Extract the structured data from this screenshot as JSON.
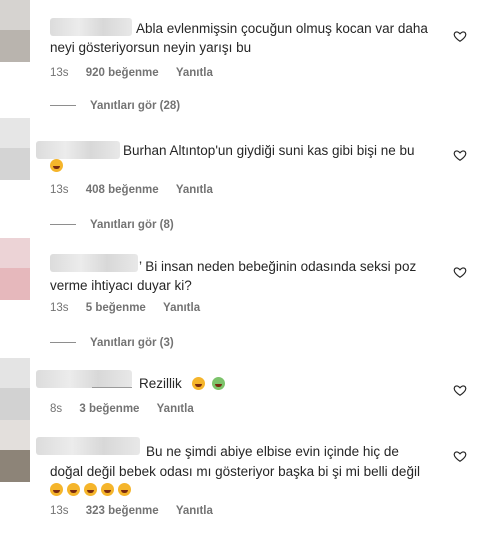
{
  "comments": [
    {
      "text_line1": "Abla evlenmişsin çocuğun olmuş kocan var daha",
      "text_line2": "neyi gösteriyorsun neyin yarışı bu",
      "time": "13s",
      "likes": "920 beğenme",
      "reply": "Yanıtla",
      "view_replies": "Yanıtları gör (28)"
    },
    {
      "text_line1": "Burhan Altıntop'un giydiği suni kas gibi bişi ne bu",
      "emojis": [
        "laughing-crying"
      ],
      "time": "13s",
      "likes": "408 beğenme",
      "reply": "Yanıtla",
      "view_replies": "Yanıtları gör (8)"
    },
    {
      "prefix_mark": "’",
      "text_line1": " Bi insan neden bebeğinin odasında seksi poz",
      "text_line2": "verme ihtiyacı duyar ki?",
      "time": "13s",
      "likes": "5 beğenme",
      "reply": "Yanıtla",
      "view_replies": "Yanıtları gör (3)"
    },
    {
      "text_line1": "Rezillik",
      "emojis": [
        "woozy-face",
        "nauseated-face"
      ],
      "time": "8s",
      "likes": "3 beğenme",
      "reply": "Yanıtla"
    },
    {
      "text_line1": "Bu ne şimdi abiye elbise evin içinde hiç de",
      "text_line2": "doğal değil bebek odası mı gösteriyor başka bi şi mi belli değil",
      "emojis": [
        "laughing-crying",
        "laughing-crying",
        "laughing-crying",
        "laughing-crying",
        "laughing-crying"
      ],
      "time": "13s",
      "likes": "323 beğenme",
      "reply": "Yanıtla"
    }
  ],
  "colors": {
    "text": "#262626",
    "meta": "#737373",
    "heart_stroke": "#262626",
    "emoji_yellow": "#f5b52b",
    "emoji_green": "#7cc36b"
  }
}
